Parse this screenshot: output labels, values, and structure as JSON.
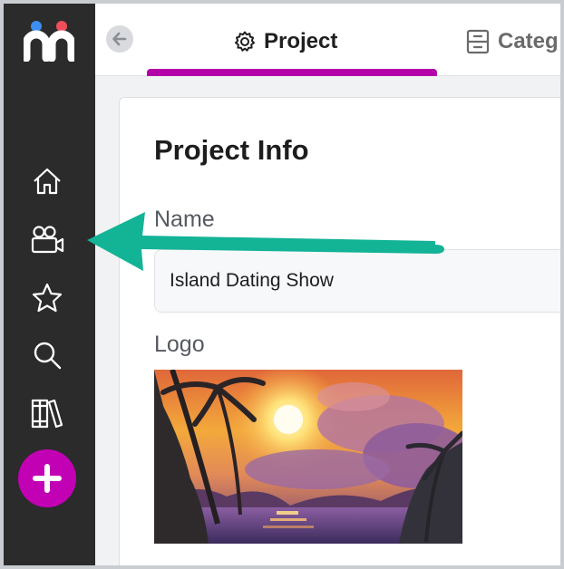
{
  "tabs": [
    {
      "label": "Project",
      "icon": "gear-icon",
      "active": true
    },
    {
      "label": "Categ",
      "icon": "cabinet-icon",
      "active": false
    }
  ],
  "project_info": {
    "title": "Project Info",
    "name_label": "Name",
    "name_value": "Island Dating Show",
    "logo_label": "Logo"
  },
  "sidebar": {
    "items": [
      {
        "name": "home-icon"
      },
      {
        "name": "projects-camera-icon"
      },
      {
        "name": "star-icon"
      },
      {
        "name": "search-icon"
      },
      {
        "name": "library-icon"
      }
    ],
    "add_button": "plus-icon"
  },
  "colors": {
    "sidebar_bg": "#2b2b2b",
    "accent": "#b400a8",
    "logo_blue": "#3d8ef0",
    "logo_red": "#ef4e5a",
    "annotation_arrow": "#13b396"
  }
}
